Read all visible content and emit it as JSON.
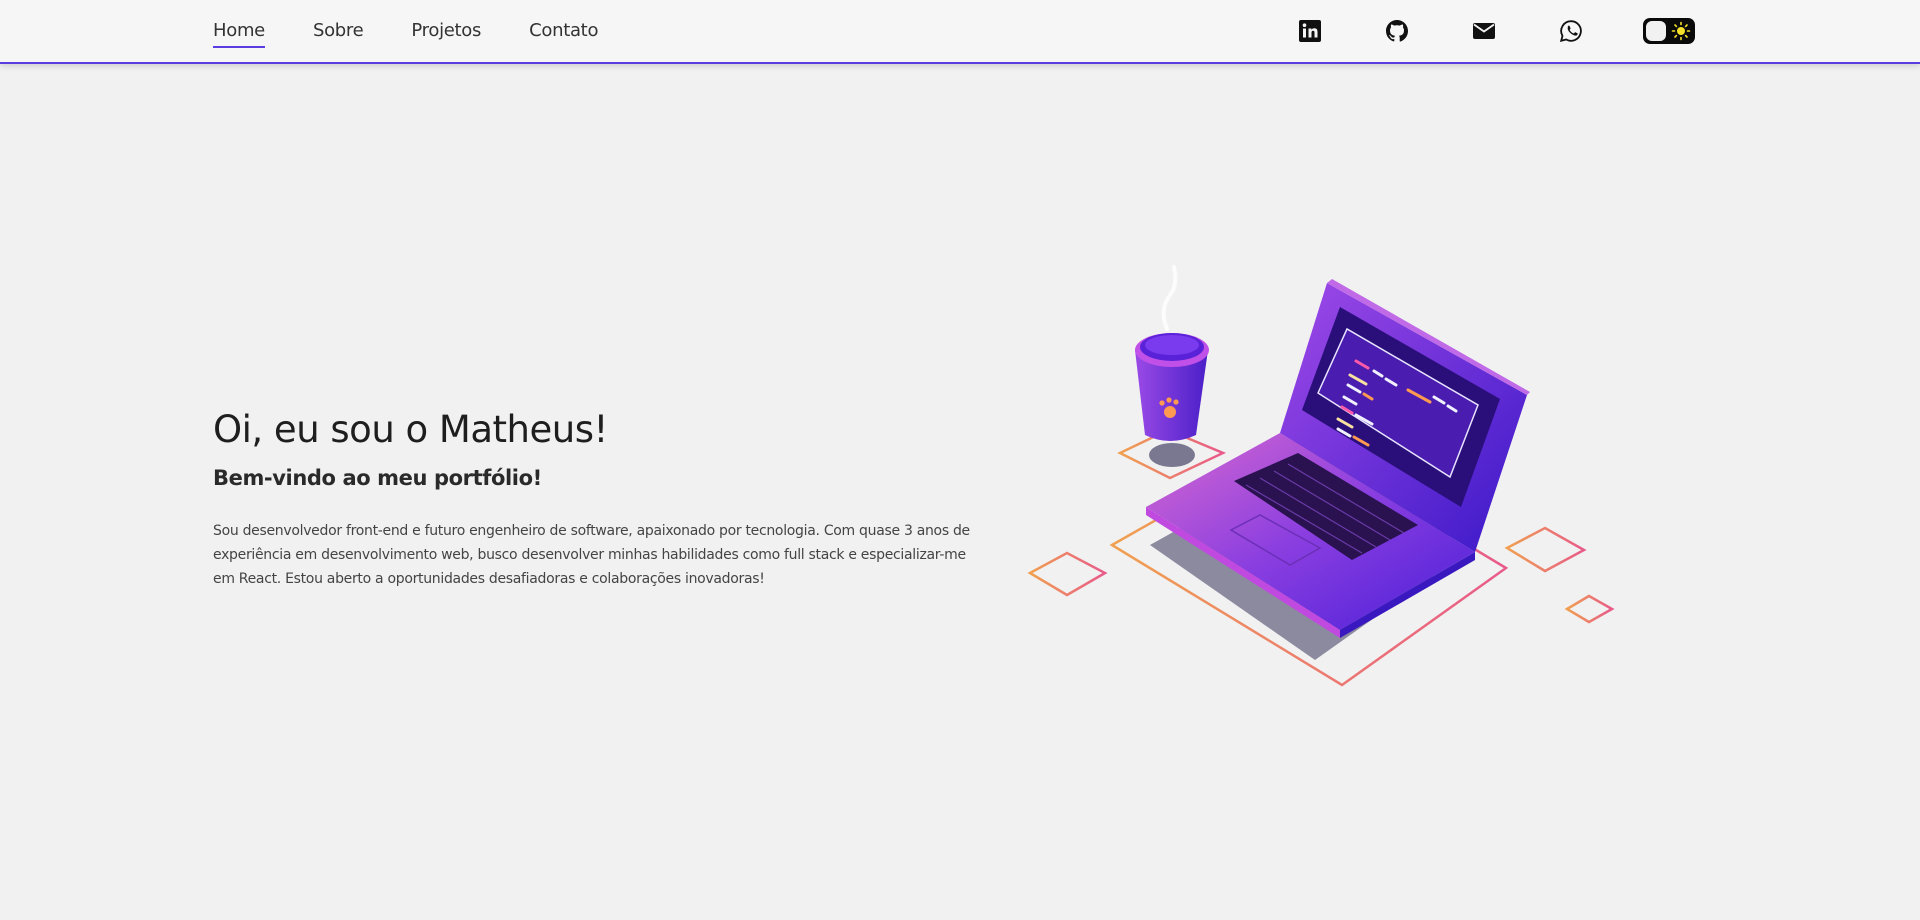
{
  "nav": {
    "items": [
      {
        "label": "Home",
        "active": true
      },
      {
        "label": "Sobre",
        "active": false
      },
      {
        "label": "Projetos",
        "active": false
      },
      {
        "label": "Contato",
        "active": false
      }
    ]
  },
  "social": {
    "icons": [
      "linkedin-icon",
      "github-icon",
      "mail-icon",
      "whatsapp-icon"
    ]
  },
  "theme_toggle": {
    "icon": "sun-icon",
    "state": "light"
  },
  "hero": {
    "title": "Oi, eu sou o Matheus!",
    "subtitle": "Bem-vindo ao meu portfólio!",
    "description": "Sou desenvolvedor front-end e futuro engenheiro de software, apaixonado por tecnologia. Com quase 3 anos de experiência em desenvolvimento web, busco desenvolver minhas habilidades como full stack e especializar-me em React. Estou aberto a oportunidades desafiadoras e colaborações inovadoras!"
  },
  "colors": {
    "accent": "#5b3ee0",
    "background": "#f1f1f1",
    "gradient_start": "#f0a050",
    "gradient_end": "#e85a8a"
  }
}
